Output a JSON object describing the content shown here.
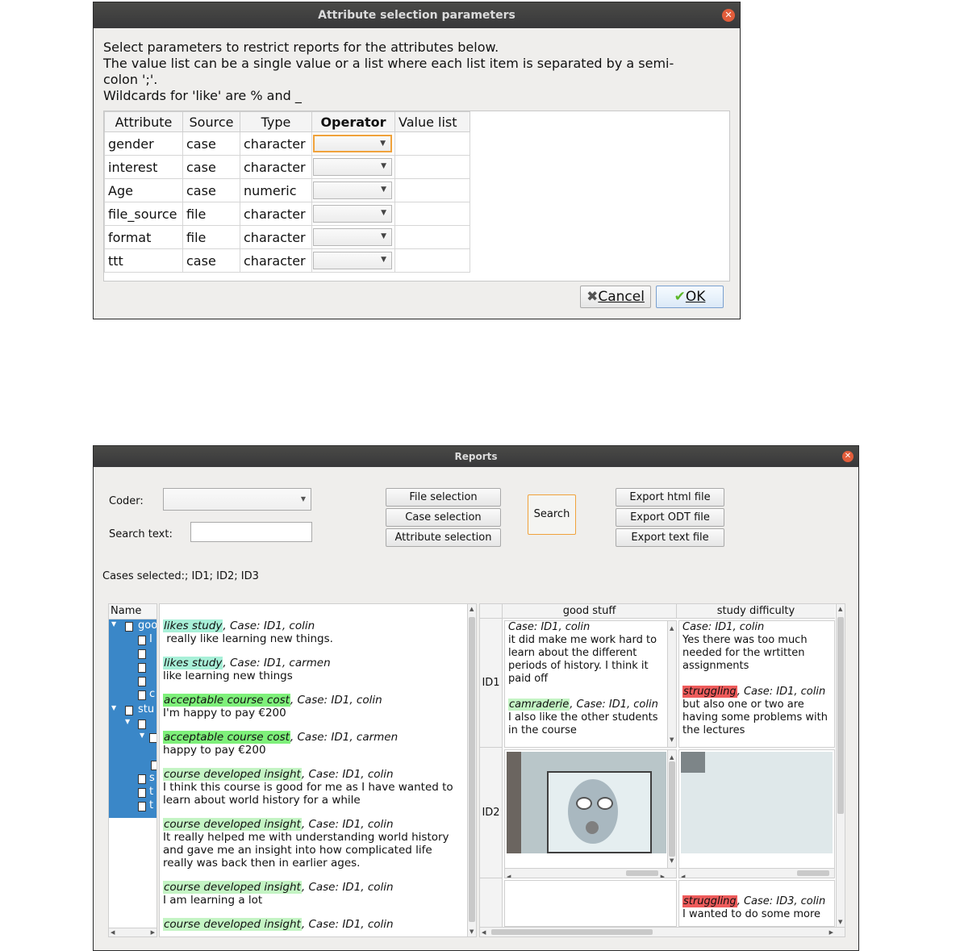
{
  "attr_dialog": {
    "title": "Attribute selection parameters",
    "instructions": [
      "Select parameters to restrict reports for the attributes below.",
      "The value list can be a single value  or a list where each list item is separated by a semi-",
      "colon ';'.",
      "Wildcards for 'like' are % and _"
    ],
    "columns": [
      "Attribute",
      "Source",
      "Type",
      "Operator",
      "Value list"
    ],
    "rows": [
      {
        "attribute": "gender",
        "source": "case",
        "type": "character",
        "operator": "",
        "value": ""
      },
      {
        "attribute": "interest",
        "source": "case",
        "type": "character",
        "operator": "",
        "value": ""
      },
      {
        "attribute": "Age",
        "source": "case",
        "type": "numeric",
        "operator": "",
        "value": ""
      },
      {
        "attribute": "file_source",
        "source": "file",
        "type": "character",
        "operator": "",
        "value": ""
      },
      {
        "attribute": "format",
        "source": "file",
        "type": "character",
        "operator": "",
        "value": ""
      },
      {
        "attribute": "ttt",
        "source": "case",
        "type": "character",
        "operator": "",
        "value": ""
      }
    ],
    "cancel_label": "Cancel",
    "ok_label": "OK"
  },
  "reports": {
    "title": "Reports",
    "coder_label": "Coder:",
    "coder_value": "",
    "search_text_label": "Search text:",
    "search_text_value": "",
    "file_selection_label": "File selection",
    "case_selection_label": "Case selection",
    "attribute_selection_label": "Attribute selection",
    "search_label": "Search",
    "export_html_label": "Export html file",
    "export_odt_label": "Export ODT file",
    "export_text_label": "Export text file",
    "cases_selected": "Cases selected:; ID1; ID2; ID3",
    "tree_header": "Name",
    "tree_fragments": [
      "goo",
      "I",
      "",
      "",
      "",
      "c",
      "stu",
      "",
      "",
      "",
      "",
      "s",
      "t",
      "t"
    ],
    "text_entries": [
      {
        "code": "likes study",
        "color": "teal",
        "meta": ", Case: ID1, colin",
        "text": " really like learning new things."
      },
      {
        "code": "likes study",
        "color": "teal",
        "meta": ", Case: ID1, carmen",
        "text": "like learning new things"
      },
      {
        "code": "acceptable course cost",
        "color": "green",
        "meta": ", Case: ID1, colin",
        "text": "I'm happy to pay €200"
      },
      {
        "code": "acceptable course cost",
        "color": "green",
        "meta": ", Case: ID1, carmen",
        "text": "happy to pay €200"
      },
      {
        "code": "course developed insight",
        "color": "lgreen",
        "meta": ", Case: ID1, colin",
        "text": "I think this course is good for me as I have wanted to learn about world history for a while"
      },
      {
        "code": "course developed insight",
        "color": "lgreen",
        "meta": ", Case: ID1, colin",
        "text": "It really helped me with understanding world history and gave me an insight into how complicated life really was back then in earlier ages."
      },
      {
        "code": "course developed insight",
        "color": "lgreen",
        "meta": ", Case: ID1, colin",
        "text": "I am learning a lot"
      },
      {
        "code": "course developed insight",
        "color": "lgreen",
        "meta": ", Case: ID1, colin",
        "text": ""
      }
    ],
    "matrix": {
      "columns": [
        "good stuff",
        "study difficulty"
      ],
      "row_labels": [
        "ID1",
        "ID2",
        ""
      ],
      "id1_good_stuff": {
        "meta1": "Case: ID1, colin",
        "text1": "it did make me work hard to learn about the different periods of history. I think it paid off",
        "code2": "camraderie",
        "meta2": ", Case: ID1, colin",
        "text2": "I also like the other students in the course"
      },
      "id1_study_difficulty": {
        "meta1": "Case: ID1, colin",
        "text1": "Yes there was too much needed for the wrtitten assignments",
        "code2": "struggling",
        "meta2": ", Case: ID1, colin",
        "text2": "but also one or two are having some problems with the lectures"
      },
      "id3_study_difficulty": {
        "code": "struggling",
        "meta": ", Case: ID3, colin",
        "text": "I wanted to do some more"
      }
    }
  }
}
